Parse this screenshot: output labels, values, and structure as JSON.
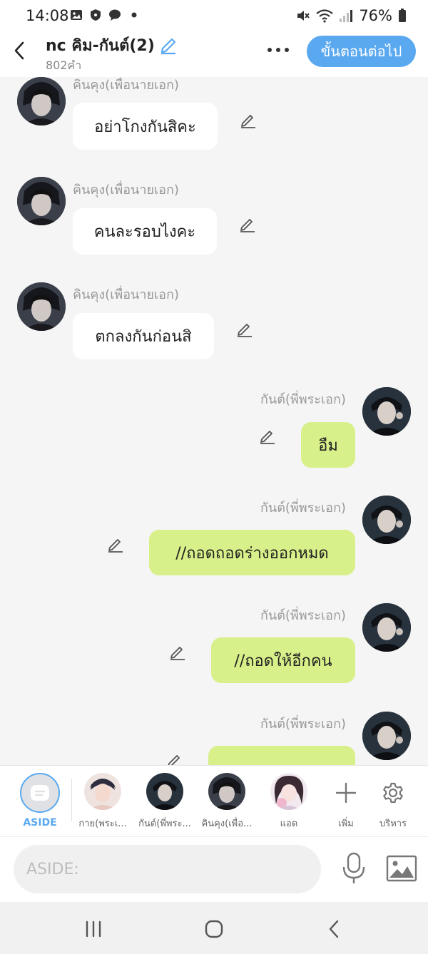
{
  "status_bar": {
    "time": "14:08",
    "battery": "76%"
  },
  "header": {
    "title": "nc คิม-กันต์(2)",
    "word_count": "802คำ",
    "next_button": "ขั้นตอนต่อไป"
  },
  "messages": [
    {
      "side": "left",
      "sender": "คินคุง(เพื่อนายเอก)",
      "text": "อย่าโกงกันสิคะ"
    },
    {
      "side": "left",
      "sender": "คินคุง(เพื่อนายเอก)",
      "text": "คนละรอบไงคะ"
    },
    {
      "side": "left",
      "sender": "คินคุง(เพื่อนายเอก)",
      "text": "ตกลงกันก่อนสิ"
    },
    {
      "side": "right",
      "sender": "กันต์(พี่พระเอก)",
      "text": "อืม"
    },
    {
      "side": "right",
      "sender": "กันต์(พี่พระเอก)",
      "text": "//ถอดถอดร่างออกหมด"
    },
    {
      "side": "right",
      "sender": "กันต์(พี่พระเอก)",
      "text": "//ถอดให้อีกคน"
    },
    {
      "side": "right",
      "sender": "กันต์(พี่พระเอก)",
      "text": ""
    }
  ],
  "characters": {
    "aside_label": "ASIDE",
    "items": [
      {
        "label": "กาย(พระเ..."
      },
      {
        "label": "กันต์(พี่พระ..."
      },
      {
        "label": "คินคุง(เพื่อ..."
      },
      {
        "label": "แอด"
      }
    ],
    "add_label": "เพิ่ม",
    "manage_label": "บริหาร"
  },
  "input": {
    "placeholder": "ASIDE:"
  },
  "colors": {
    "accent": "#5aa9f0",
    "right_bubble": "#d8f08a",
    "left_bubble": "#ffffff",
    "background": "#f5f5f5"
  }
}
